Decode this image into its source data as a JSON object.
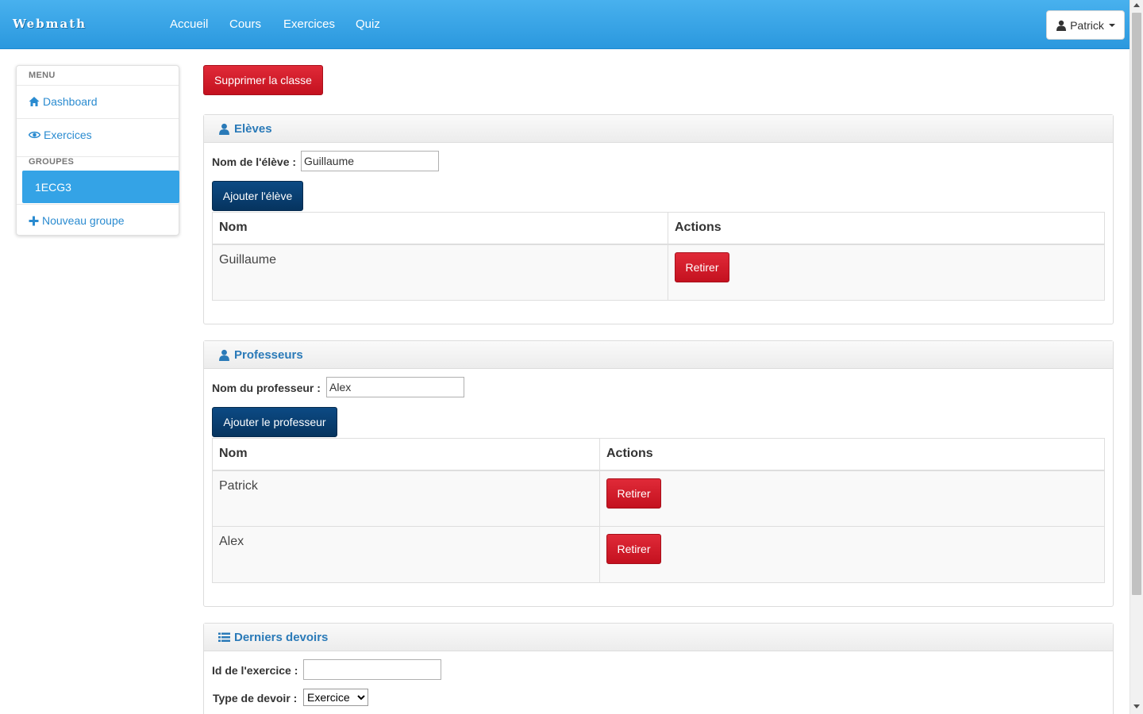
{
  "navbar": {
    "brand": "Webmath",
    "links": [
      "Accueil",
      "Cours",
      "Exercices",
      "Quiz"
    ],
    "user": "Patrick"
  },
  "sidebar": {
    "menu_header": "MENU",
    "menu_items": [
      {
        "label": "Dashboard",
        "icon": "home-icon"
      },
      {
        "label": "Exercices",
        "icon": "eye-icon"
      }
    ],
    "groups_header": "GROUPES",
    "groups": [
      {
        "label": "1ECG3",
        "active": true
      }
    ],
    "new_group_label": "Nouveau groupe"
  },
  "actions": {
    "delete_class": "Supprimer la classe"
  },
  "students": {
    "title": "Elèves",
    "field_label": "Nom de l'élève :",
    "field_value": "Guillaume",
    "add_button": "Ajouter l'élève",
    "columns": [
      "Nom",
      "Actions"
    ],
    "rows": [
      {
        "name": "Guillaume",
        "action": "Retirer"
      }
    ]
  },
  "teachers": {
    "title": "Professeurs",
    "field_label": "Nom du professeur :",
    "field_value": "Alex",
    "add_button": "Ajouter le professeur",
    "columns": [
      "Nom",
      "Actions"
    ],
    "rows": [
      {
        "name": "Patrick",
        "action": "Retirer"
      },
      {
        "name": "Alex",
        "action": "Retirer"
      }
    ]
  },
  "homework": {
    "title": "Derniers devoirs",
    "exercise_id_label": "Id de l'exercice :",
    "exercise_id_value": "",
    "type_label": "Type de devoir :",
    "type_selected": "Exercice"
  },
  "colors": {
    "navbar": "#3aa7e9",
    "danger": "#d11a27",
    "primary_dark": "#0a3f72",
    "link": "#2a8bd0"
  }
}
